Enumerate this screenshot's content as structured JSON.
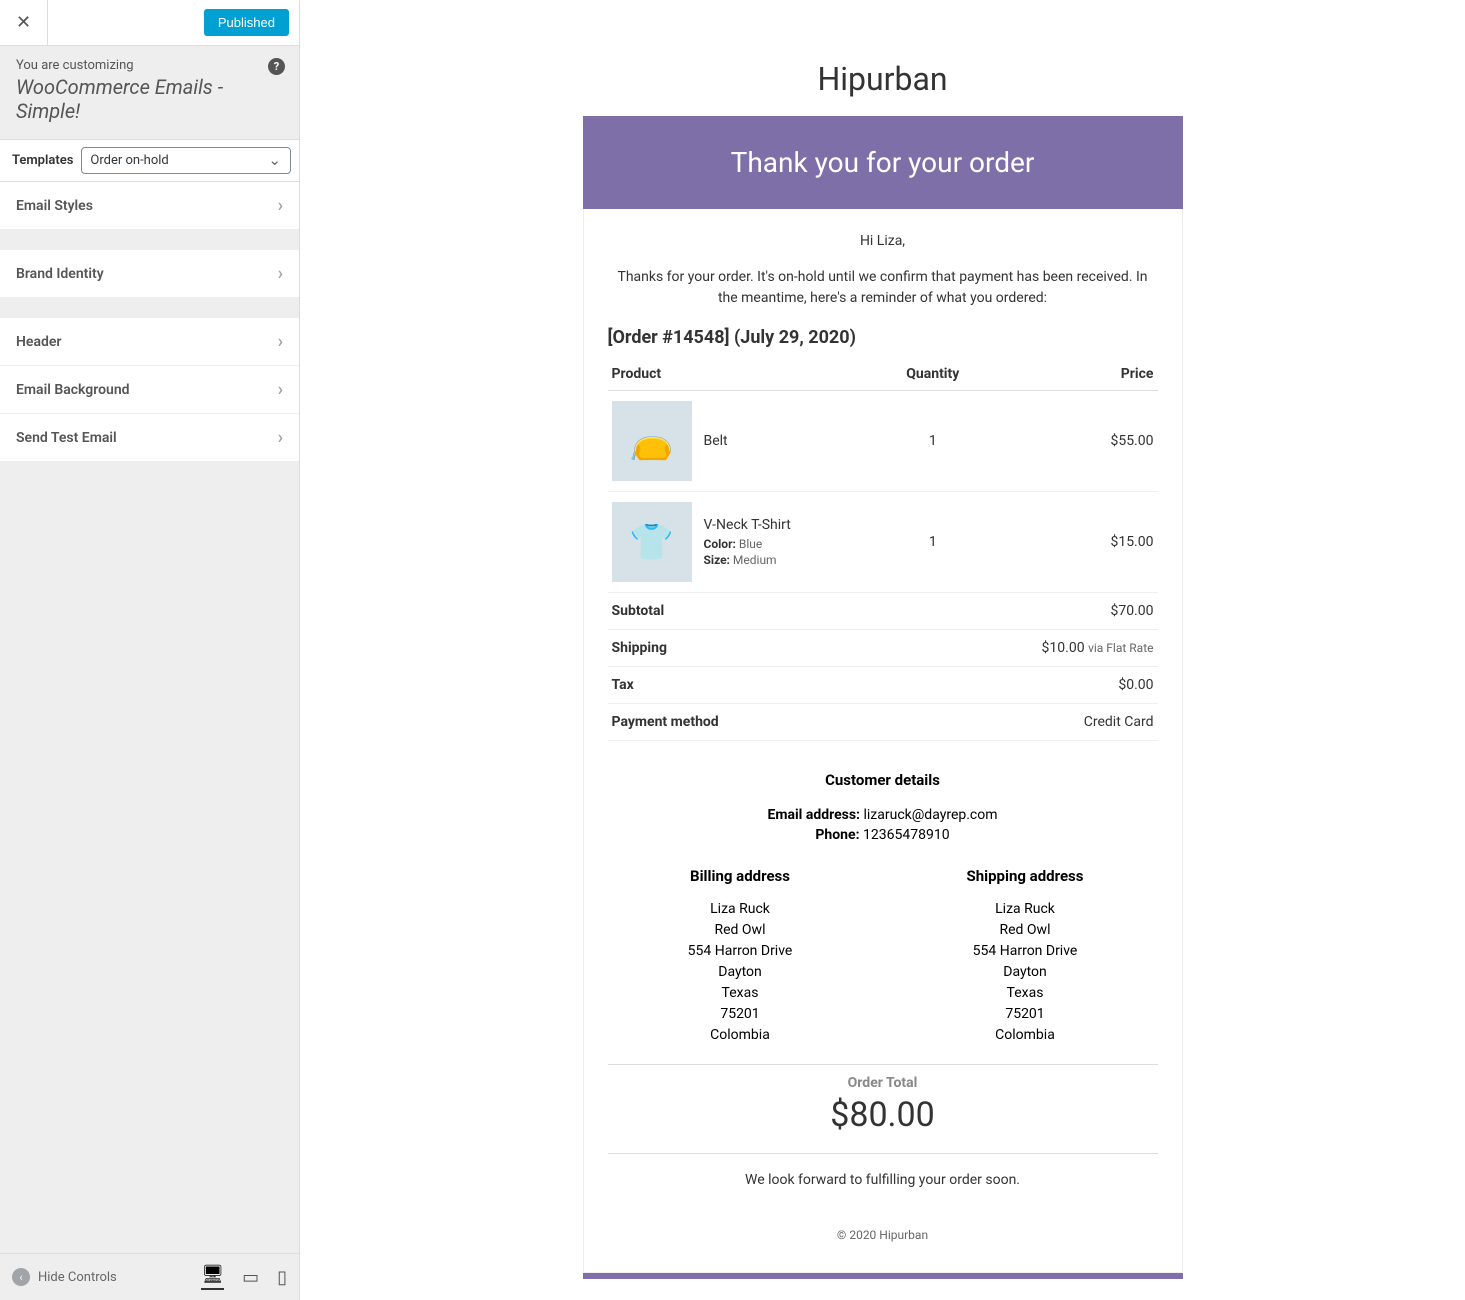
{
  "sidebar": {
    "publish_label": "Published",
    "customizing_label": "You are customizing",
    "customizing_title": "WooCommerce Emails - Simple!",
    "templates_label": "Templates",
    "templates_selected": "Order on-hold",
    "nav": {
      "email_styles": "Email Styles",
      "brand_identity": "Brand Identity",
      "header": "Header",
      "email_background": "Email Background",
      "send_test": "Send Test Email"
    },
    "hide_controls": "Hide Controls"
  },
  "email": {
    "site_title": "Hipurban",
    "header": "Thank you for your order",
    "greeting": "Hi Liza,",
    "intro": "Thanks for your order. It's on-hold until we confirm that payment has been received. In the meantime, here's a reminder of what you ordered:",
    "order_heading": "[Order #14548] (July 29, 2020)",
    "columns": {
      "product": "Product",
      "quantity": "Quantity",
      "price": "Price"
    },
    "items": [
      {
        "name": "Belt",
        "icon": "👝",
        "qty": "1",
        "price": "$55.00",
        "attrs": []
      },
      {
        "name": "V-Neck T-Shirt",
        "icon": "👕",
        "qty": "1",
        "price": "$15.00",
        "attrs": [
          {
            "label": "Color:",
            "value": "Blue"
          },
          {
            "label": "Size:",
            "value": "Medium"
          }
        ]
      }
    ],
    "totals": [
      {
        "label": "Subtotal",
        "value": "$70.00",
        "note": ""
      },
      {
        "label": "Shipping",
        "value": "$10.00",
        "note": "via Flat Rate"
      },
      {
        "label": "Tax",
        "value": "$0.00",
        "note": ""
      },
      {
        "label": "Payment method",
        "value": "Credit Card",
        "note": ""
      }
    ],
    "customer": {
      "heading": "Customer details",
      "email_label": "Email address:",
      "email": "lizaruck@dayrep.com",
      "phone_label": "Phone:",
      "phone": "12365478910"
    },
    "billing": {
      "heading": "Billing address",
      "lines": [
        "Liza Ruck",
        "Red Owl",
        "554 Harron Drive",
        "Dayton",
        "Texas",
        "75201",
        "Colombia"
      ]
    },
    "shipping": {
      "heading": "Shipping address",
      "lines": [
        "Liza Ruck",
        "Red Owl",
        "554 Harron Drive",
        "Dayton",
        "Texas",
        "75201",
        "Colombia"
      ]
    },
    "order_total_label": "Order Total",
    "order_total_value": "$80.00",
    "closing": "We look forward to fulfilling your order soon.",
    "footer": "© 2020 Hipurban"
  }
}
